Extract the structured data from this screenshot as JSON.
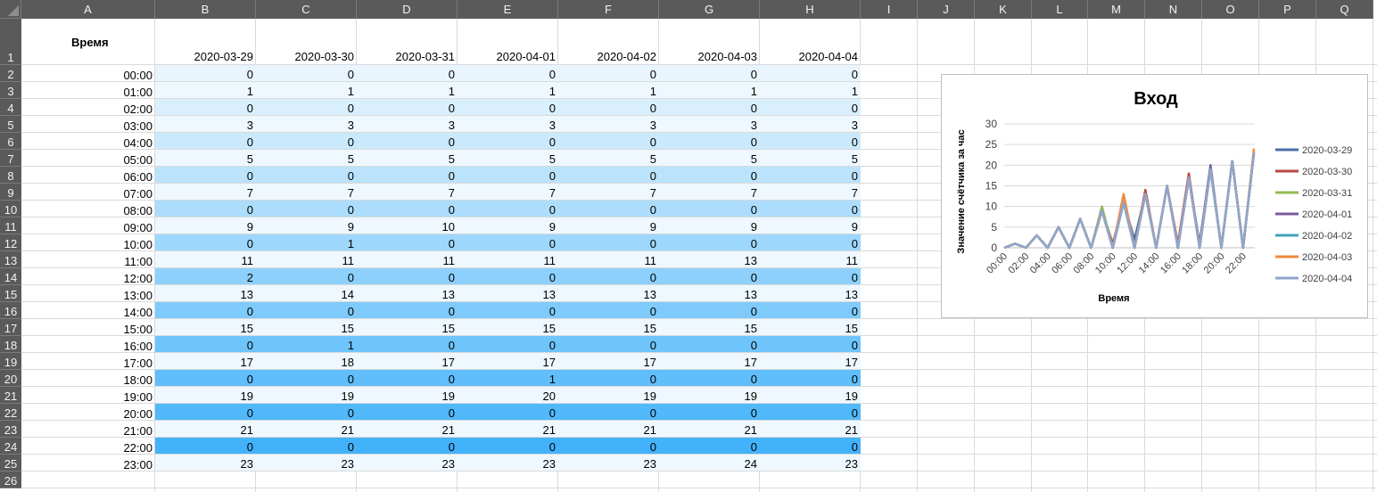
{
  "columns": [
    "A",
    "B",
    "C",
    "D",
    "E",
    "F",
    "G",
    "H",
    "I",
    "J",
    "K",
    "L",
    "M",
    "N",
    "O",
    "P",
    "Q"
  ],
  "header": {
    "time_label": "Время",
    "dates": [
      "2020-03-29",
      "2020-03-30",
      "2020-03-31",
      "2020-04-01",
      "2020-04-02",
      "2020-04-03",
      "2020-04-04"
    ]
  },
  "row_numbers": [
    "1",
    "2",
    "3",
    "4",
    "5",
    "6",
    "7",
    "8",
    "9",
    "10",
    "11",
    "12",
    "13",
    "14",
    "15",
    "16",
    "17",
    "18",
    "19",
    "20",
    "21",
    "22",
    "23",
    "24",
    "25",
    "26"
  ],
  "rows": [
    {
      "time": "00:00",
      "values": [
        "0",
        "0",
        "0",
        "0",
        "0",
        "0",
        "0"
      ]
    },
    {
      "time": "01:00",
      "values": [
        "1",
        "1",
        "1",
        "1",
        "1",
        "1",
        "1"
      ]
    },
    {
      "time": "02:00",
      "values": [
        "0",
        "0",
        "0",
        "0",
        "0",
        "0",
        "0"
      ]
    },
    {
      "time": "03:00",
      "values": [
        "3",
        "3",
        "3",
        "3",
        "3",
        "3",
        "3"
      ]
    },
    {
      "time": "04:00",
      "values": [
        "0",
        "0",
        "0",
        "0",
        "0",
        "0",
        "0"
      ]
    },
    {
      "time": "05:00",
      "values": [
        "5",
        "5",
        "5",
        "5",
        "5",
        "5",
        "5"
      ]
    },
    {
      "time": "06:00",
      "values": [
        "0",
        "0",
        "0",
        "0",
        "0",
        "0",
        "0"
      ]
    },
    {
      "time": "07:00",
      "values": [
        "7",
        "7",
        "7",
        "7",
        "7",
        "7",
        "7"
      ]
    },
    {
      "time": "08:00",
      "values": [
        "0",
        "0",
        "0",
        "0",
        "0",
        "0",
        "0"
      ]
    },
    {
      "time": "09:00",
      "values": [
        "9",
        "9",
        "10",
        "9",
        "9",
        "9",
        "9"
      ]
    },
    {
      "time": "10:00",
      "values": [
        "0",
        "1",
        "0",
        "0",
        "0",
        "0",
        "0"
      ]
    },
    {
      "time": "11:00",
      "values": [
        "11",
        "11",
        "11",
        "11",
        "11",
        "13",
        "11"
      ]
    },
    {
      "time": "12:00",
      "values": [
        "2",
        "0",
        "0",
        "0",
        "0",
        "0",
        "0"
      ]
    },
    {
      "time": "13:00",
      "values": [
        "13",
        "14",
        "13",
        "13",
        "13",
        "13",
        "13"
      ]
    },
    {
      "time": "14:00",
      "values": [
        "0",
        "0",
        "0",
        "0",
        "0",
        "0",
        "0"
      ]
    },
    {
      "time": "15:00",
      "values": [
        "15",
        "15",
        "15",
        "15",
        "15",
        "15",
        "15"
      ]
    },
    {
      "time": "16:00",
      "values": [
        "0",
        "1",
        "0",
        "0",
        "0",
        "0",
        "0"
      ]
    },
    {
      "time": "17:00",
      "values": [
        "17",
        "18",
        "17",
        "17",
        "17",
        "17",
        "17"
      ]
    },
    {
      "time": "18:00",
      "values": [
        "0",
        "0",
        "0",
        "1",
        "0",
        "0",
        "0"
      ]
    },
    {
      "time": "19:00",
      "values": [
        "19",
        "19",
        "19",
        "20",
        "19",
        "19",
        "19"
      ]
    },
    {
      "time": "20:00",
      "values": [
        "0",
        "0",
        "0",
        "0",
        "0",
        "0",
        "0"
      ]
    },
    {
      "time": "21:00",
      "values": [
        "21",
        "21",
        "21",
        "21",
        "21",
        "21",
        "21"
      ]
    },
    {
      "time": "22:00",
      "values": [
        "0",
        "0",
        "0",
        "0",
        "0",
        "0",
        "0"
      ]
    },
    {
      "time": "23:00",
      "values": [
        "23",
        "23",
        "23",
        "23",
        "23",
        "24",
        "23"
      ]
    }
  ],
  "chart_data": {
    "type": "line",
    "title": "Вход",
    "xlabel": "Время",
    "ylabel": "Значение счётчика за час",
    "ylim": [
      0,
      30
    ],
    "yticks": [
      "0",
      "5",
      "10",
      "15",
      "20",
      "25",
      "30"
    ],
    "x": [
      "00:00",
      "01:00",
      "02:00",
      "03:00",
      "04:00",
      "05:00",
      "06:00",
      "07:00",
      "08:00",
      "09:00",
      "10:00",
      "11:00",
      "12:00",
      "13:00",
      "14:00",
      "15:00",
      "16:00",
      "17:00",
      "18:00",
      "19:00",
      "20:00",
      "21:00",
      "22:00",
      "23:00"
    ],
    "xtick_labels": [
      "00:00",
      "02:00",
      "04:00",
      "06:00",
      "08:00",
      "10:00",
      "12:00",
      "14:00",
      "16:00",
      "18:00",
      "20:00",
      "22:00"
    ],
    "grid": true,
    "legend_position": "right",
    "series": [
      {
        "name": "2020-03-29",
        "color": "#4a6da7",
        "values": [
          0,
          1,
          0,
          3,
          0,
          5,
          0,
          7,
          0,
          9,
          0,
          11,
          2,
          13,
          0,
          15,
          0,
          17,
          0,
          19,
          0,
          21,
          0,
          23
        ]
      },
      {
        "name": "2020-03-30",
        "color": "#b94745",
        "values": [
          0,
          1,
          0,
          3,
          0,
          5,
          0,
          7,
          0,
          9,
          1,
          11,
          0,
          14,
          0,
          15,
          1,
          18,
          0,
          19,
          0,
          21,
          0,
          23
        ]
      },
      {
        "name": "2020-03-31",
        "color": "#94b956",
        "values": [
          0,
          1,
          0,
          3,
          0,
          5,
          0,
          7,
          0,
          10,
          0,
          11,
          0,
          13,
          0,
          15,
          0,
          17,
          0,
          19,
          0,
          21,
          0,
          23
        ]
      },
      {
        "name": "2020-04-01",
        "color": "#7a5a9c",
        "values": [
          0,
          1,
          0,
          3,
          0,
          5,
          0,
          7,
          0,
          9,
          0,
          11,
          0,
          13,
          0,
          15,
          0,
          17,
          1,
          20,
          0,
          21,
          0,
          23
        ]
      },
      {
        "name": "2020-04-02",
        "color": "#3fa3b8",
        "values": [
          0,
          1,
          0,
          3,
          0,
          5,
          0,
          7,
          0,
          9,
          0,
          11,
          0,
          13,
          0,
          15,
          0,
          17,
          0,
          19,
          0,
          21,
          0,
          23
        ]
      },
      {
        "name": "2020-04-03",
        "color": "#f08a3c",
        "values": [
          0,
          1,
          0,
          3,
          0,
          5,
          0,
          7,
          0,
          9,
          0,
          13,
          0,
          13,
          0,
          15,
          0,
          17,
          0,
          19,
          0,
          21,
          0,
          24
        ]
      },
      {
        "name": "2020-04-04",
        "color": "#8fa6cc",
        "values": [
          0,
          1,
          0,
          3,
          0,
          5,
          0,
          7,
          0,
          9,
          0,
          11,
          0,
          13,
          0,
          15,
          0,
          17,
          0,
          19,
          0,
          21,
          0,
          23
        ]
      }
    ]
  }
}
